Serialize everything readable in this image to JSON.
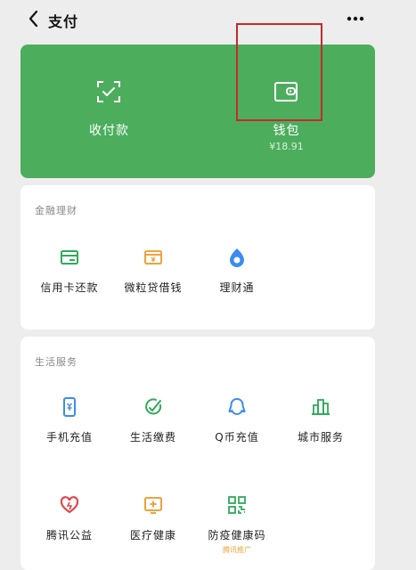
{
  "header": {
    "title": "支付"
  },
  "wallet_card": {
    "collect_label": "收付款",
    "wallet_label": "钱包",
    "wallet_balance": "¥18.91"
  },
  "finance": {
    "section_title": "金融理财",
    "items": [
      {
        "label": "信用卡还款",
        "icon": "credit-card-icon"
      },
      {
        "label": "微粒贷借钱",
        "icon": "loan-wallet-icon"
      },
      {
        "label": "理财通",
        "icon": "wealth-drop-icon"
      }
    ]
  },
  "life_services": {
    "section_title": "生活服务",
    "items": [
      {
        "label": "手机充值",
        "icon": "mobile-topup-icon"
      },
      {
        "label": "生活缴费",
        "icon": "utility-bill-icon"
      },
      {
        "label": "Q币充值",
        "icon": "qq-coin-icon"
      },
      {
        "label": "城市服务",
        "icon": "city-service-icon"
      },
      {
        "label": "腾讯公益",
        "icon": "charity-heart-icon"
      },
      {
        "label": "医疗健康",
        "icon": "medical-health-icon"
      },
      {
        "label": "防疫健康码",
        "icon": "health-code-icon",
        "tag": "腾讯推广"
      }
    ]
  },
  "colors": {
    "brand_green": "#4cae5d",
    "finance_green": "#2faa5a",
    "orange": "#f0a23b",
    "blue": "#3d8bf0",
    "highlight_red": "#c8282d"
  }
}
